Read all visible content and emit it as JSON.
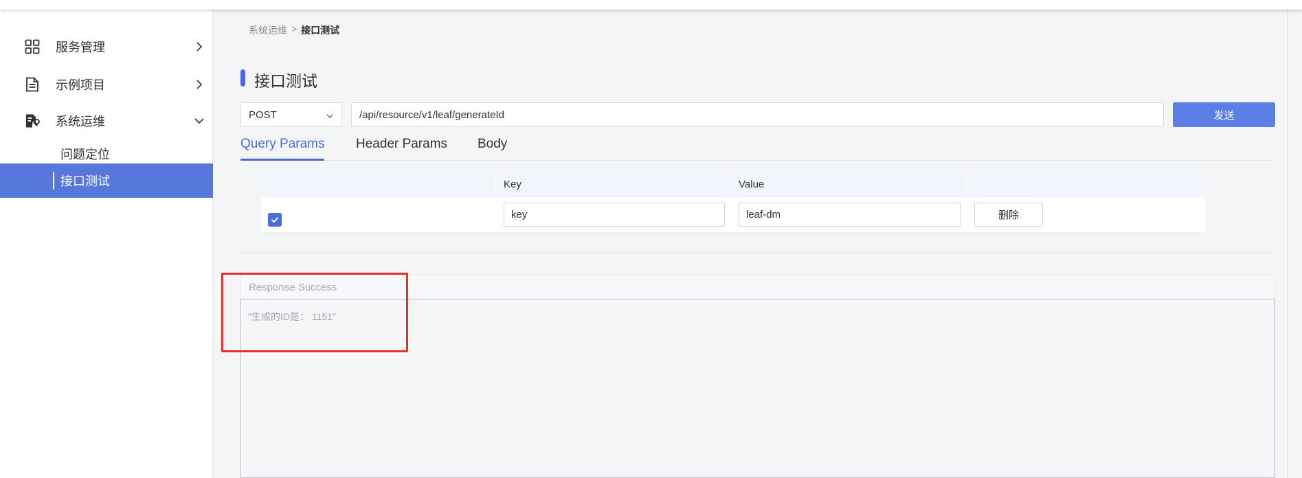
{
  "sidebar": {
    "menus": [
      {
        "label": "服务管理",
        "icon": "grid-icon",
        "expanded": false
      },
      {
        "label": "示例项目",
        "icon": "document-icon",
        "expanded": false
      },
      {
        "label": "系统运维",
        "icon": "maintenance-icon",
        "expanded": true
      }
    ],
    "sub_items": [
      {
        "label": "问题定位",
        "active": false
      },
      {
        "label": "接口测试",
        "active": true
      }
    ]
  },
  "breadcrumb": {
    "parent": "系统运维",
    "separator": ">",
    "current": "接口测试"
  },
  "page": {
    "title": "接口测试"
  },
  "request": {
    "method": "POST",
    "url": "/api/resource/v1/leaf/generateId",
    "send_label": "发送"
  },
  "tabs": [
    {
      "label": "Query Params",
      "active": true
    },
    {
      "label": "Header Params",
      "active": false
    },
    {
      "label": "Body",
      "active": false
    }
  ],
  "params_table": {
    "columns": [
      "",
      "Key",
      "Value",
      ""
    ],
    "rows": [
      {
        "checked": true,
        "key": "key",
        "value": "leaf-dm",
        "delete_label": "删除"
      }
    ]
  },
  "response": {
    "status": "Response Success",
    "body": "\"生成的ID是： 1151\""
  },
  "colors": {
    "accent": "#4a6bdc",
    "active_menu_bg": "#5677dc",
    "send_button": "#5b7fe6",
    "highlight": "#e5302f"
  }
}
